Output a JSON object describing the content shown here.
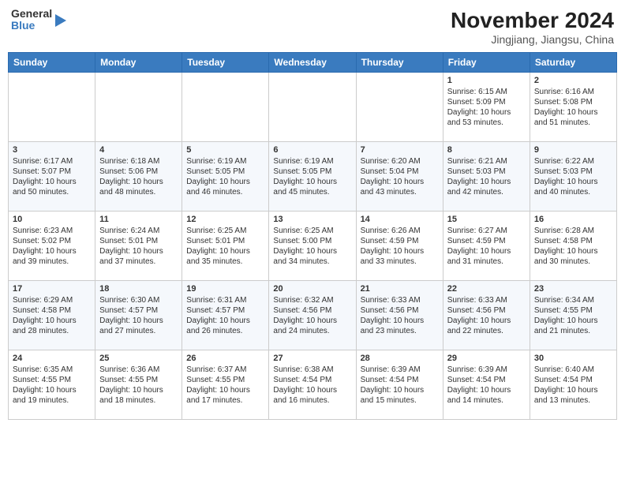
{
  "logo": {
    "line1": "General",
    "line2": "Blue"
  },
  "title": "November 2024",
  "subtitle": "Jingjiang, Jiangsu, China",
  "weekdays": [
    "Sunday",
    "Monday",
    "Tuesday",
    "Wednesday",
    "Thursday",
    "Friday",
    "Saturday"
  ],
  "weeks": [
    [
      {
        "day": "",
        "content": ""
      },
      {
        "day": "",
        "content": ""
      },
      {
        "day": "",
        "content": ""
      },
      {
        "day": "",
        "content": ""
      },
      {
        "day": "",
        "content": ""
      },
      {
        "day": "1",
        "content": "Sunrise: 6:15 AM\nSunset: 5:09 PM\nDaylight: 10 hours\nand 53 minutes."
      },
      {
        "day": "2",
        "content": "Sunrise: 6:16 AM\nSunset: 5:08 PM\nDaylight: 10 hours\nand 51 minutes."
      }
    ],
    [
      {
        "day": "3",
        "content": "Sunrise: 6:17 AM\nSunset: 5:07 PM\nDaylight: 10 hours\nand 50 minutes."
      },
      {
        "day": "4",
        "content": "Sunrise: 6:18 AM\nSunset: 5:06 PM\nDaylight: 10 hours\nand 48 minutes."
      },
      {
        "day": "5",
        "content": "Sunrise: 6:19 AM\nSunset: 5:05 PM\nDaylight: 10 hours\nand 46 minutes."
      },
      {
        "day": "6",
        "content": "Sunrise: 6:19 AM\nSunset: 5:05 PM\nDaylight: 10 hours\nand 45 minutes."
      },
      {
        "day": "7",
        "content": "Sunrise: 6:20 AM\nSunset: 5:04 PM\nDaylight: 10 hours\nand 43 minutes."
      },
      {
        "day": "8",
        "content": "Sunrise: 6:21 AM\nSunset: 5:03 PM\nDaylight: 10 hours\nand 42 minutes."
      },
      {
        "day": "9",
        "content": "Sunrise: 6:22 AM\nSunset: 5:03 PM\nDaylight: 10 hours\nand 40 minutes."
      }
    ],
    [
      {
        "day": "10",
        "content": "Sunrise: 6:23 AM\nSunset: 5:02 PM\nDaylight: 10 hours\nand 39 minutes."
      },
      {
        "day": "11",
        "content": "Sunrise: 6:24 AM\nSunset: 5:01 PM\nDaylight: 10 hours\nand 37 minutes."
      },
      {
        "day": "12",
        "content": "Sunrise: 6:25 AM\nSunset: 5:01 PM\nDaylight: 10 hours\nand 35 minutes."
      },
      {
        "day": "13",
        "content": "Sunrise: 6:25 AM\nSunset: 5:00 PM\nDaylight: 10 hours\nand 34 minutes."
      },
      {
        "day": "14",
        "content": "Sunrise: 6:26 AM\nSunset: 4:59 PM\nDaylight: 10 hours\nand 33 minutes."
      },
      {
        "day": "15",
        "content": "Sunrise: 6:27 AM\nSunset: 4:59 PM\nDaylight: 10 hours\nand 31 minutes."
      },
      {
        "day": "16",
        "content": "Sunrise: 6:28 AM\nSunset: 4:58 PM\nDaylight: 10 hours\nand 30 minutes."
      }
    ],
    [
      {
        "day": "17",
        "content": "Sunrise: 6:29 AM\nSunset: 4:58 PM\nDaylight: 10 hours\nand 28 minutes."
      },
      {
        "day": "18",
        "content": "Sunrise: 6:30 AM\nSunset: 4:57 PM\nDaylight: 10 hours\nand 27 minutes."
      },
      {
        "day": "19",
        "content": "Sunrise: 6:31 AM\nSunset: 4:57 PM\nDaylight: 10 hours\nand 26 minutes."
      },
      {
        "day": "20",
        "content": "Sunrise: 6:32 AM\nSunset: 4:56 PM\nDaylight: 10 hours\nand 24 minutes."
      },
      {
        "day": "21",
        "content": "Sunrise: 6:33 AM\nSunset: 4:56 PM\nDaylight: 10 hours\nand 23 minutes."
      },
      {
        "day": "22",
        "content": "Sunrise: 6:33 AM\nSunset: 4:56 PM\nDaylight: 10 hours\nand 22 minutes."
      },
      {
        "day": "23",
        "content": "Sunrise: 6:34 AM\nSunset: 4:55 PM\nDaylight: 10 hours\nand 21 minutes."
      }
    ],
    [
      {
        "day": "24",
        "content": "Sunrise: 6:35 AM\nSunset: 4:55 PM\nDaylight: 10 hours\nand 19 minutes."
      },
      {
        "day": "25",
        "content": "Sunrise: 6:36 AM\nSunset: 4:55 PM\nDaylight: 10 hours\nand 18 minutes."
      },
      {
        "day": "26",
        "content": "Sunrise: 6:37 AM\nSunset: 4:55 PM\nDaylight: 10 hours\nand 17 minutes."
      },
      {
        "day": "27",
        "content": "Sunrise: 6:38 AM\nSunset: 4:54 PM\nDaylight: 10 hours\nand 16 minutes."
      },
      {
        "day": "28",
        "content": "Sunrise: 6:39 AM\nSunset: 4:54 PM\nDaylight: 10 hours\nand 15 minutes."
      },
      {
        "day": "29",
        "content": "Sunrise: 6:39 AM\nSunset: 4:54 PM\nDaylight: 10 hours\nand 14 minutes."
      },
      {
        "day": "30",
        "content": "Sunrise: 6:40 AM\nSunset: 4:54 PM\nDaylight: 10 hours\nand 13 minutes."
      }
    ]
  ]
}
